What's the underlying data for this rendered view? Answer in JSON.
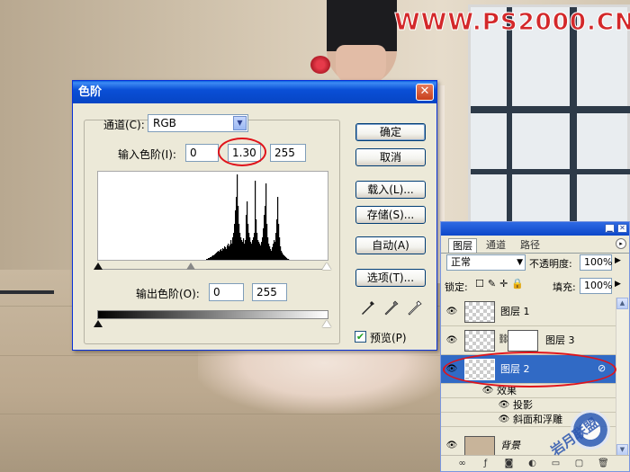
{
  "watermark": "WWW.PS2000.CN",
  "dialog": {
    "title": "色阶",
    "close_glyph": "✕",
    "channel_label": "通道(C):",
    "channel_value": "RGB",
    "input_levels_label": "输入色阶(I):",
    "input_black": "0",
    "input_gamma": "1.30",
    "input_white": "255",
    "output_levels_label": "输出色阶(O):",
    "output_black": "0",
    "output_white": "255",
    "buttons": {
      "ok": "确定",
      "cancel": "取消",
      "load": "载入(L)...",
      "save": "存储(S)...",
      "auto": "自动(A)",
      "options": "选项(T)..."
    },
    "preview_label": "预览(P)",
    "preview_checked": true,
    "histogram_heights": [
      0,
      0,
      0,
      0,
      0,
      0,
      0,
      0,
      0,
      0,
      0,
      0,
      0,
      0,
      0,
      0,
      0,
      0,
      0,
      0,
      0,
      0,
      0,
      0,
      0,
      0,
      0,
      0,
      0,
      0,
      0,
      0,
      0,
      0,
      0,
      0,
      0,
      0,
      0,
      0,
      0,
      0,
      0,
      0,
      0,
      0,
      0,
      0,
      0,
      0,
      0,
      0,
      0,
      0,
      0,
      0,
      0,
      0,
      0,
      0,
      0,
      0,
      0,
      0,
      0,
      0,
      0,
      0,
      0,
      0,
      0,
      0,
      0,
      0,
      0,
      0,
      0,
      0,
      0,
      0,
      0,
      0,
      0,
      0,
      0,
      0,
      0,
      0,
      0,
      0,
      0,
      0,
      0,
      0,
      0,
      0,
      0,
      0,
      0,
      0,
      0,
      0,
      0,
      0,
      0,
      0,
      0,
      0,
      0,
      0,
      0,
      0,
      0,
      0,
      0,
      0,
      0,
      0,
      0,
      0,
      1,
      1,
      2,
      2,
      3,
      3,
      4,
      5,
      5,
      6,
      7,
      8,
      9,
      10,
      9,
      11,
      12,
      10,
      13,
      12,
      15,
      14,
      12,
      16,
      18,
      15,
      17,
      22,
      18,
      25,
      30,
      40,
      55,
      70,
      95,
      60,
      40,
      30,
      25,
      22,
      20,
      24,
      18,
      22,
      50,
      65,
      40,
      30,
      25,
      20,
      18,
      22,
      25,
      30,
      88,
      45,
      30,
      22,
      20,
      18,
      16,
      20,
      25,
      35,
      50,
      60,
      85,
      40,
      25,
      18,
      15,
      12,
      10,
      14,
      18,
      22,
      20,
      30,
      45,
      70,
      40,
      25,
      15,
      10,
      8,
      6,
      5,
      4,
      3,
      2,
      1,
      1,
      0,
      0,
      0,
      0,
      0,
      0,
      0,
      0,
      0,
      0,
      0,
      0,
      0,
      0,
      0,
      0,
      0,
      0,
      0,
      0,
      0,
      0,
      0,
      0,
      0,
      0,
      0,
      0,
      0,
      0,
      0,
      0,
      0,
      0,
      0,
      0,
      0,
      0,
      0,
      0,
      0,
      0,
      0,
      0,
      0,
      0,
      0,
      0,
      0,
      0,
      0,
      0,
      0,
      0,
      0,
      0,
      0,
      0,
      0,
      0,
      0,
      0,
      0,
      0,
      0,
      0
    ]
  },
  "layers_panel": {
    "tabs": [
      "图层",
      "通道",
      "路径"
    ],
    "blend_mode": "正常",
    "opacity_label": "不透明度:",
    "opacity_value": "100%",
    "lock_label": "锁定:",
    "fill_label": "填充:",
    "fill_value": "100%",
    "layers": [
      {
        "name": "图层 1",
        "selected": false
      },
      {
        "name": "图层 3",
        "selected": false
      },
      {
        "name": "图层 2",
        "selected": true
      }
    ],
    "effects_label": "效果",
    "effects": [
      "投影",
      "斜面和浮雕"
    ],
    "background_layer": "背景"
  },
  "logo_text": "岩月联盟"
}
